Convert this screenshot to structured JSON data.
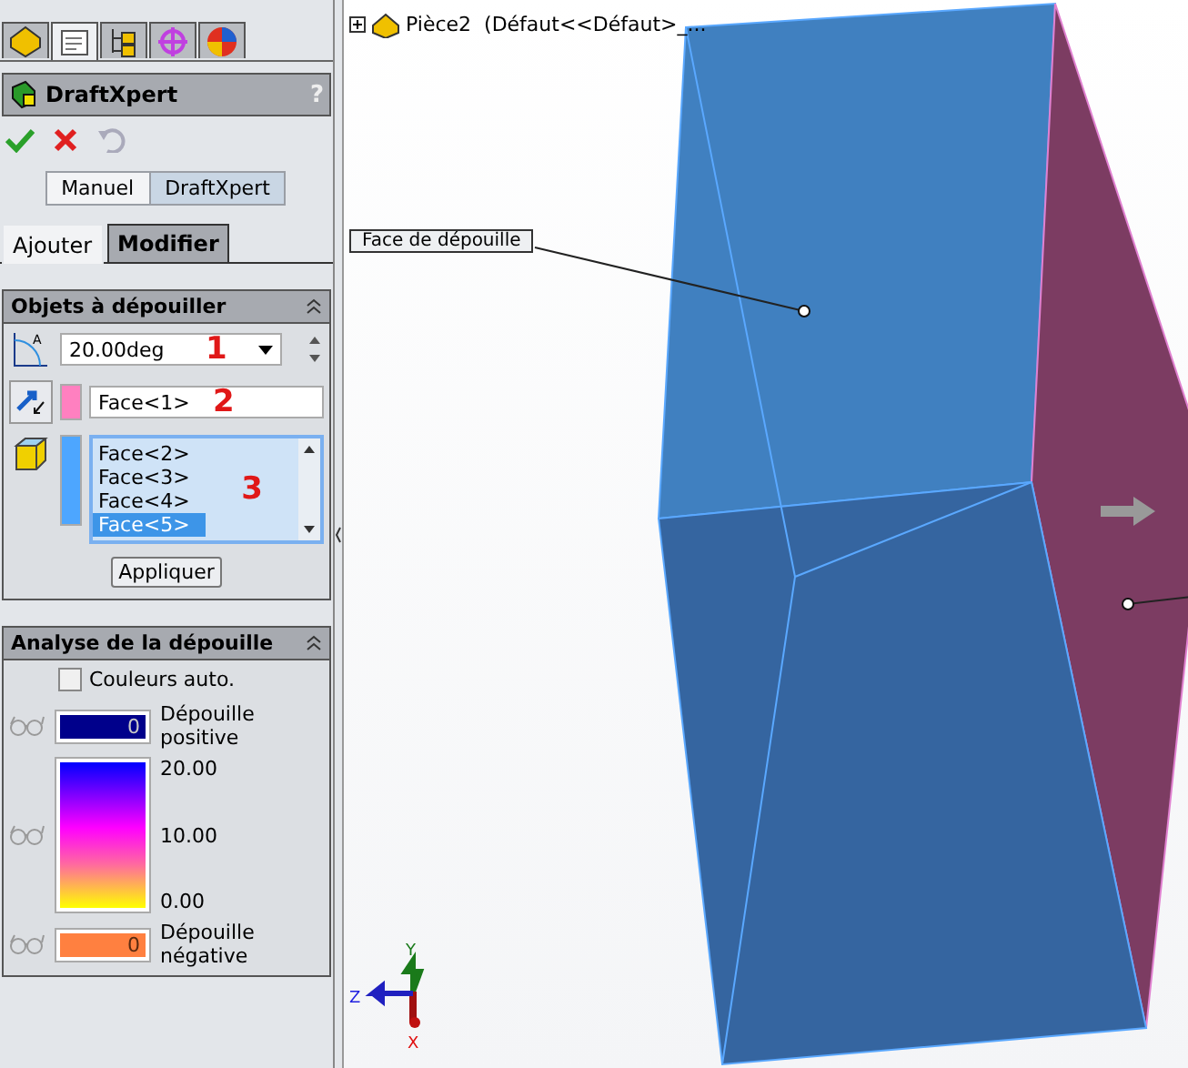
{
  "property_tabs": [
    {
      "selected": false
    },
    {
      "selected": true
    },
    {
      "selected": false
    },
    {
      "selected": false
    },
    {
      "selected": false
    }
  ],
  "panel": {
    "title": "DraftXpert",
    "help": "?"
  },
  "modes": [
    {
      "label": "Manuel",
      "selected": false
    },
    {
      "label": "DraftXpert",
      "selected": true
    }
  ],
  "tabs": [
    {
      "label": "Ajouter",
      "selected": true
    },
    {
      "label": "Modifier",
      "selected": false
    }
  ],
  "draft_group": {
    "title": "Objets à dépouiller",
    "angle_icon_letter": "A",
    "angle": "20.00deg",
    "neutral_face": "Face<1>",
    "faces": [
      {
        "label": "Face<2>",
        "selected": false
      },
      {
        "label": "Face<3>",
        "selected": false
      },
      {
        "label": "Face<4>",
        "selected": false
      },
      {
        "label": "Face<5>",
        "selected": true
      }
    ],
    "markers": [
      "1",
      "2",
      "3"
    ],
    "apply": "Appliquer"
  },
  "analysis": {
    "title": "Analyse de la dépouille",
    "auto_colors": {
      "label": "Couleurs auto.",
      "checked": false
    },
    "positive": {
      "count": "0",
      "label": "Dépouille positive"
    },
    "scale": [
      "20.00",
      "10.00",
      "0.00"
    ],
    "negative": {
      "count": "0",
      "label": "Dépouille négative"
    }
  },
  "viewport": {
    "tree_item": "Pièce2  (Défaut<<Défaut>_...",
    "callout": "Face de dépouille",
    "triad": [
      "Y",
      "Z",
      "X"
    ]
  }
}
